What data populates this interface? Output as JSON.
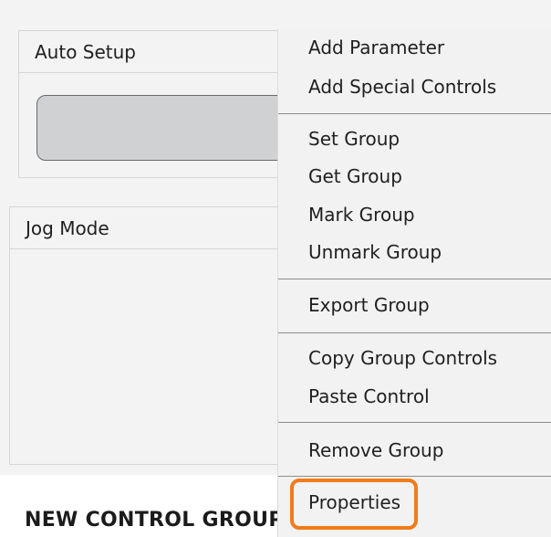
{
  "panels": {
    "auto_setup": {
      "title": "Auto Setup"
    },
    "jog_mode": {
      "title": "Jog Mode"
    },
    "new_group_label": "NEW CONTROL GROUP"
  },
  "context_menu": {
    "items": [
      {
        "label": "Add Parameter"
      },
      {
        "label": "Add Special Controls"
      },
      {
        "label": "Set Group"
      },
      {
        "label": "Get Group"
      },
      {
        "label": "Mark Group"
      },
      {
        "label": "Unmark Group"
      },
      {
        "label": "Export Group"
      },
      {
        "label": "Copy Group Controls"
      },
      {
        "label": "Paste Control"
      },
      {
        "label": "Remove Group"
      },
      {
        "label": "Properties"
      }
    ]
  },
  "colors": {
    "highlight": "#f07c1a",
    "menu_background": "#f2f2f2",
    "button_fill": "#cfd1d3"
  }
}
